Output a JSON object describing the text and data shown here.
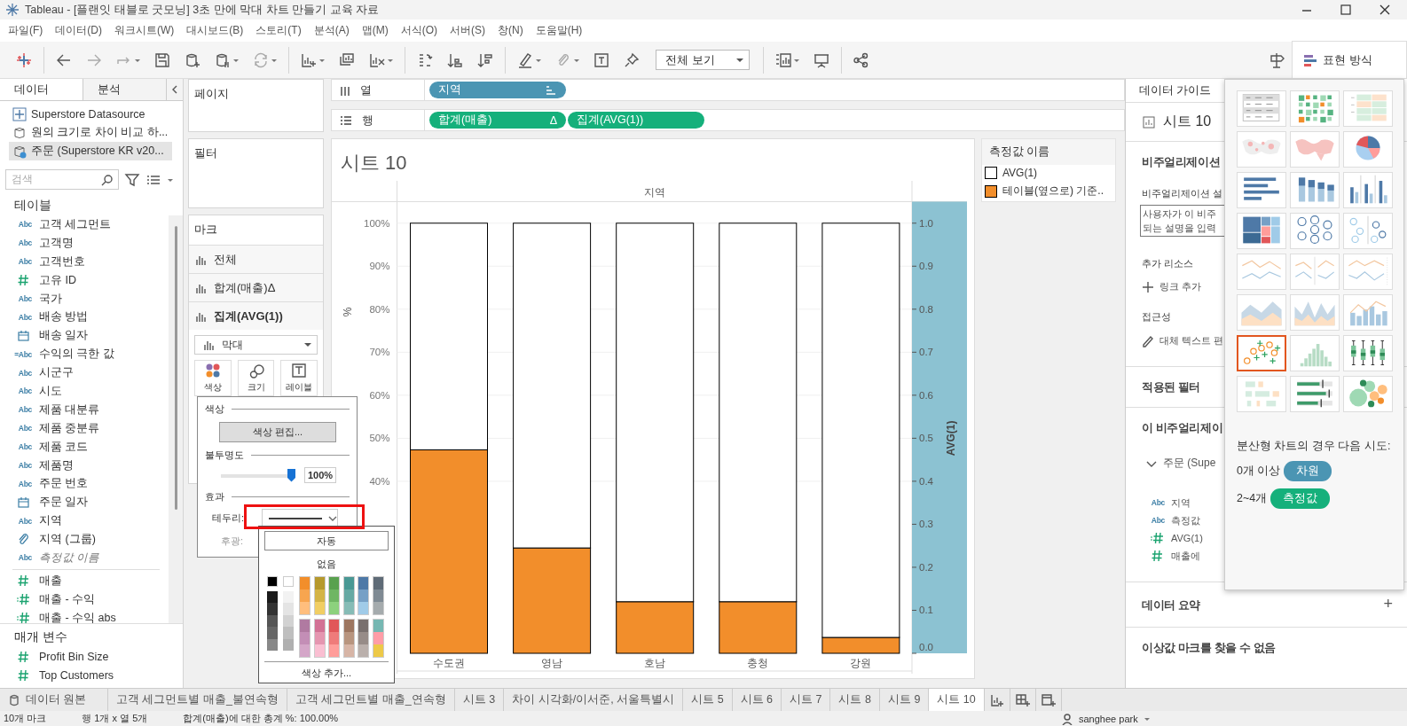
{
  "window": {
    "title": "Tableau - [플랜잇 태블로 굿모닝] 3초 만에 막대 차트 만들기 교육 자료"
  },
  "menu": [
    "파일(F)",
    "데이터(D)",
    "워크시트(W)",
    "대시보드(B)",
    "스토리(T)",
    "분석(A)",
    "맵(M)",
    "서식(O)",
    "서버(S)",
    "창(N)",
    "도움말(H)"
  ],
  "toolbar": {
    "fit": "전체 보기",
    "show_me_tab": "표현 방식"
  },
  "data_pane": {
    "tabs": [
      {
        "label": "데이터",
        "selected": true
      },
      {
        "label": "분석",
        "selected": false
      }
    ],
    "sources": [
      {
        "name": "Superstore Datasource",
        "kind": "extract",
        "selected": false
      },
      {
        "name": "원의 크기로 차이 비교 하...",
        "kind": "database",
        "selected": false
      },
      {
        "name": "주문 (Superstore KR v20...",
        "kind": "live",
        "selected": true
      }
    ],
    "search": {
      "placeholder": "검색"
    },
    "tables_title": "테이블",
    "fields": [
      {
        "name": "고객 세그먼트",
        "kind": "abc",
        "badge": "Abc",
        "italic": false
      },
      {
        "name": "고객명",
        "kind": "abc",
        "badge": "Abc",
        "italic": false
      },
      {
        "name": "고객번호",
        "kind": "abc",
        "badge": "Abc",
        "italic": false
      },
      {
        "name": "고유 ID",
        "kind": "num",
        "italic": false
      },
      {
        "name": "국가",
        "kind": "abc",
        "badge": "Abc",
        "italic": false
      },
      {
        "name": "배송 방법",
        "kind": "abc",
        "badge": "Abc",
        "italic": false
      },
      {
        "name": "배송 일자",
        "kind": "date",
        "italic": false
      },
      {
        "name": "수익의 극한 값",
        "kind": "abc",
        "badge": "=Abc",
        "italic": false
      },
      {
        "name": "시군구",
        "kind": "abc",
        "badge": "Abc",
        "italic": false
      },
      {
        "name": "시도",
        "kind": "abc",
        "badge": "Abc",
        "italic": false
      },
      {
        "name": "제품 대분류",
        "kind": "abc",
        "badge": "Abc",
        "italic": false
      },
      {
        "name": "제품 중분류",
        "kind": "abc",
        "badge": "Abc",
        "italic": false
      },
      {
        "name": "제품 코드",
        "kind": "abc",
        "badge": "Abc",
        "italic": false
      },
      {
        "name": "제품명",
        "kind": "abc",
        "badge": "Abc",
        "italic": false
      },
      {
        "name": "주문 번호",
        "kind": "abc",
        "badge": "Abc",
        "italic": false
      },
      {
        "name": "주문 일자",
        "kind": "date",
        "italic": false
      },
      {
        "name": "지역",
        "kind": "abc",
        "badge": "Abc",
        "italic": false
      },
      {
        "name": "지역 (그룹)",
        "kind": "group",
        "italic": false
      },
      {
        "name": "측정값 이름",
        "kind": "abc",
        "badge": "Abc",
        "italic": true
      }
    ],
    "measures": [
      {
        "name": "매출",
        "kind": "num"
      },
      {
        "name": "매출 - 수익",
        "kind": "calc_num"
      },
      {
        "name": "매출 - 수익 abs",
        "kind": "calc_num"
      }
    ],
    "params_title": "매개 변수",
    "params": [
      {
        "name": "Profit Bin Size",
        "kind": "num"
      },
      {
        "name": "Top Customers",
        "kind": "num"
      }
    ]
  },
  "shelves": {
    "pages": "페이지",
    "filters": "필터",
    "columns_label": "열",
    "rows_label": "행",
    "columns": [
      {
        "label": "지역",
        "kind": "dimension"
      }
    ],
    "rows": [
      {
        "label": "합계(매출)",
        "kind": "measure",
        "flag": "Δ"
      },
      {
        "label": "집계(AVG(1))",
        "kind": "measure"
      }
    ]
  },
  "marks": {
    "title": "마크",
    "layers": [
      {
        "label": "전체",
        "selected": false
      },
      {
        "label": "합계(매출)",
        "flag": "Δ",
        "selected": false
      },
      {
        "label": "집계(AVG(1))",
        "selected": true
      }
    ],
    "mark_type": "막대",
    "buttons": [
      {
        "label": "색상",
        "kind": "color"
      },
      {
        "label": "크기",
        "kind": "size"
      },
      {
        "label": "레이블",
        "kind": "label"
      }
    ]
  },
  "color_popup": {
    "color_title": "색상",
    "edit_button": "색상 편집...",
    "opacity_title": "불투명도",
    "opacity": {
      "level": 1,
      "reading": "100%"
    },
    "effects_title": "효과",
    "border_label": "테두리:",
    "halo": {
      "label": "후광:",
      "disabled": true
    }
  },
  "palette": {
    "auto": "자동",
    "none": "없음",
    "basic": [
      {
        "color": "#000000"
      },
      {
        "color": "#ffffff"
      }
    ],
    "gray_columns": [
      {
        "swatches": [
          {
            "color": "#1b1b1b"
          },
          {
            "color": "#333333"
          },
          {
            "color": "#555555"
          },
          {
            "color": "#666666"
          },
          {
            "color": "#888888"
          }
        ]
      },
      {
        "swatches": [
          {
            "color": "#f2f2f2"
          },
          {
            "color": "#e4e4e4"
          },
          {
            "color": "#d2d2d2"
          },
          {
            "color": "#bfbfbf"
          },
          {
            "color": "#b0b0b0"
          }
        ]
      }
    ],
    "top_columns": [
      {
        "swatches": [
          {
            "color": "#f28e2b"
          },
          {
            "color": "#f7a54f"
          },
          {
            "color": "#ffbe7d"
          }
        ]
      },
      {
        "swatches": [
          {
            "color": "#b6992d"
          },
          {
            "color": "#d4b446"
          },
          {
            "color": "#f1ce63"
          }
        ]
      },
      {
        "swatches": [
          {
            "color": "#59a14f"
          },
          {
            "color": "#6fb663"
          },
          {
            "color": "#8cd17d"
          }
        ]
      },
      {
        "swatches": [
          {
            "color": "#499894"
          },
          {
            "color": "#66a9a3"
          },
          {
            "color": "#86bcb6"
          }
        ]
      },
      {
        "swatches": [
          {
            "color": "#4e79a7"
          },
          {
            "color": "#76a0c6"
          },
          {
            "color": "#a0cbe8"
          }
        ]
      },
      {
        "swatches": [
          {
            "color": "#5f6b77"
          },
          {
            "color": "#7f8a93"
          },
          {
            "color": "#a5abad"
          }
        ]
      }
    ],
    "bottom_columns": [
      {
        "swatches": [
          {
            "color": "#b07aa1"
          },
          {
            "color": "#c38eb6"
          },
          {
            "color": "#d4a6c8"
          }
        ]
      },
      {
        "swatches": [
          {
            "color": "#d37295"
          },
          {
            "color": "#e596b0"
          },
          {
            "color": "#fabfd2"
          }
        ]
      },
      {
        "swatches": [
          {
            "color": "#e15759"
          },
          {
            "color": "#ef7b7a"
          },
          {
            "color": "#ff9d9a"
          }
        ]
      },
      {
        "swatches": [
          {
            "color": "#9d7660"
          },
          {
            "color": "#b8957f"
          },
          {
            "color": "#d7b5a6"
          }
        ]
      },
      {
        "swatches": [
          {
            "color": "#79706e"
          },
          {
            "color": "#978c88"
          },
          {
            "color": "#bab0ac"
          }
        ]
      },
      {
        "swatches": [
          {
            "color": "#76b7b2"
          },
          {
            "color": "#ff9da7"
          },
          {
            "color": "#edc948"
          }
        ]
      }
    ],
    "add": "색상 추가..."
  },
  "sheet": {
    "title": "시트 10",
    "header": "지역",
    "chart_data": {
      "type": "bar",
      "categories": [
        "수도권",
        "영남",
        "호남",
        "충청",
        "강원"
      ],
      "series": [
        {
          "name": "테이블(옆으로) 기준..",
          "color": "#f28e2b",
          "values": [
            0.473,
            0.245,
            0.12,
            0.12,
            0.037
          ]
        },
        {
          "name": "AVG(1)",
          "color": "#ffffff",
          "values": [
            0.527,
            0.755,
            0.88,
            0.88,
            0.963
          ]
        }
      ],
      "stacked": true,
      "grid": true,
      "legend": "right",
      "ylabel": "%",
      "ylim": [
        0,
        1.05
      ],
      "yticks": [
        {
          "value": 0.4,
          "label": "40%"
        },
        {
          "value": 0.5,
          "label": "50%"
        },
        {
          "value": 0.6,
          "label": "60%"
        },
        {
          "value": 0.7,
          "label": "70%"
        },
        {
          "value": 0.8,
          "label": "80%"
        },
        {
          "value": 0.9,
          "label": "90%"
        },
        {
          "value": 1,
          "label": "100%"
        }
      ]
    },
    "right_axis": {
      "title": "AVG(1)",
      "ticks": [
        "1.0",
        "0.9",
        "0.8",
        "0.7",
        "0.6",
        "0.5",
        "0.4",
        "0.3",
        "0.2",
        "0.1",
        "0.0"
      ]
    }
  },
  "legend": {
    "title": "측정값 이름"
  },
  "data_guide": {
    "tab": "데이터 가이드",
    "sheet": "시트 10",
    "viz_heading": "비주얼리제이션",
    "desc_label": "비주얼리제이션 설",
    "desc_lines": [
      "사용자가 이 비주",
      "되는 설명을 입력"
    ],
    "resources": "추가 리소스",
    "add_link": "링크 추가",
    "access": "접근성",
    "alt_text": "대체 텍스트 편",
    "filters": "적용된 필터",
    "fields_heading": "이 비주얼리제이",
    "source": "주문 (Supe",
    "fields": [
      {
        "name": "지역",
        "kind": "abc",
        "badge": "Abc"
      },
      {
        "name": "측정값",
        "kind": "abc",
        "badge": "Abc"
      },
      {
        "name": "AVG(1)",
        "kind": "calc_num"
      },
      {
        "name": "매출에",
        "kind": "num"
      }
    ],
    "summary": "데이터 요약",
    "summary_action": "+",
    "outliers": "이상값 마크를 찾을 수 없음"
  },
  "show_me": {
    "charts": [
      {
        "kind": "text_table",
        "selected": false
      },
      {
        "kind": "heat_map",
        "selected": false
      },
      {
        "kind": "highlight_table",
        "selected": false
      },
      {
        "kind": "symbol_map",
        "selected": false
      },
      {
        "kind": "filled_map",
        "selected": false
      },
      {
        "kind": "pie",
        "selected": false
      },
      {
        "kind": "hbar",
        "selected": false
      },
      {
        "kind": "stacked_bar",
        "selected": false
      },
      {
        "kind": "side_bar",
        "selected": false
      },
      {
        "kind": "treemap",
        "selected": false
      },
      {
        "kind": "circle_view",
        "selected": false
      },
      {
        "kind": "side_circle",
        "selected": false
      },
      {
        "kind": "lines_discrete",
        "selected": false
      },
      {
        "kind": "lines_continuous",
        "selected": false
      },
      {
        "kind": "dual_lines",
        "selected": false
      },
      {
        "kind": "area_continuous",
        "selected": false
      },
      {
        "kind": "area_discrete",
        "selected": false
      },
      {
        "kind": "dual_combo",
        "selected": false
      },
      {
        "kind": "scatter",
        "selected": true
      },
      {
        "kind": "histogram",
        "selected": false
      },
      {
        "kind": "box_plot",
        "selected": false
      },
      {
        "kind": "gantt",
        "selected": false
      },
      {
        "kind": "bullet",
        "selected": false
      },
      {
        "kind": "packed_bubbles",
        "selected": false
      }
    ],
    "hint": "분산형 차트의 경우 다음 시도:",
    "requirements": [
      {
        "count": "0개 이상",
        "pill": "차원",
        "kind": "dimension"
      },
      {
        "count": "2~4개",
        "pill": "측정값",
        "kind": "measure"
      }
    ]
  },
  "tabs": {
    "data_source": "데이터 원본",
    "sheets": [
      {
        "label": "고객 세그먼트별 매출_불연속형",
        "selected": false
      },
      {
        "label": "고객 세그먼트별 매출_연속형",
        "selected": false
      },
      {
        "label": "시트 3",
        "selected": false
      },
      {
        "label": "차이 시각화/이서준, 서울특별시",
        "selected": false
      },
      {
        "label": "시트 5",
        "selected": false
      },
      {
        "label": "시트 6",
        "selected": false
      },
      {
        "label": "시트 7",
        "selected": false
      },
      {
        "label": "시트 8",
        "selected": false
      },
      {
        "label": "시트 9",
        "selected": false
      },
      {
        "label": "시트 10",
        "selected": true
      }
    ]
  },
  "status": {
    "marks": "10개 마크",
    "dims": "행 1개 x 열 5개",
    "total": "합계(매출)에 대한 총계 %: 100.00%",
    "user": "sanghee park"
  }
}
